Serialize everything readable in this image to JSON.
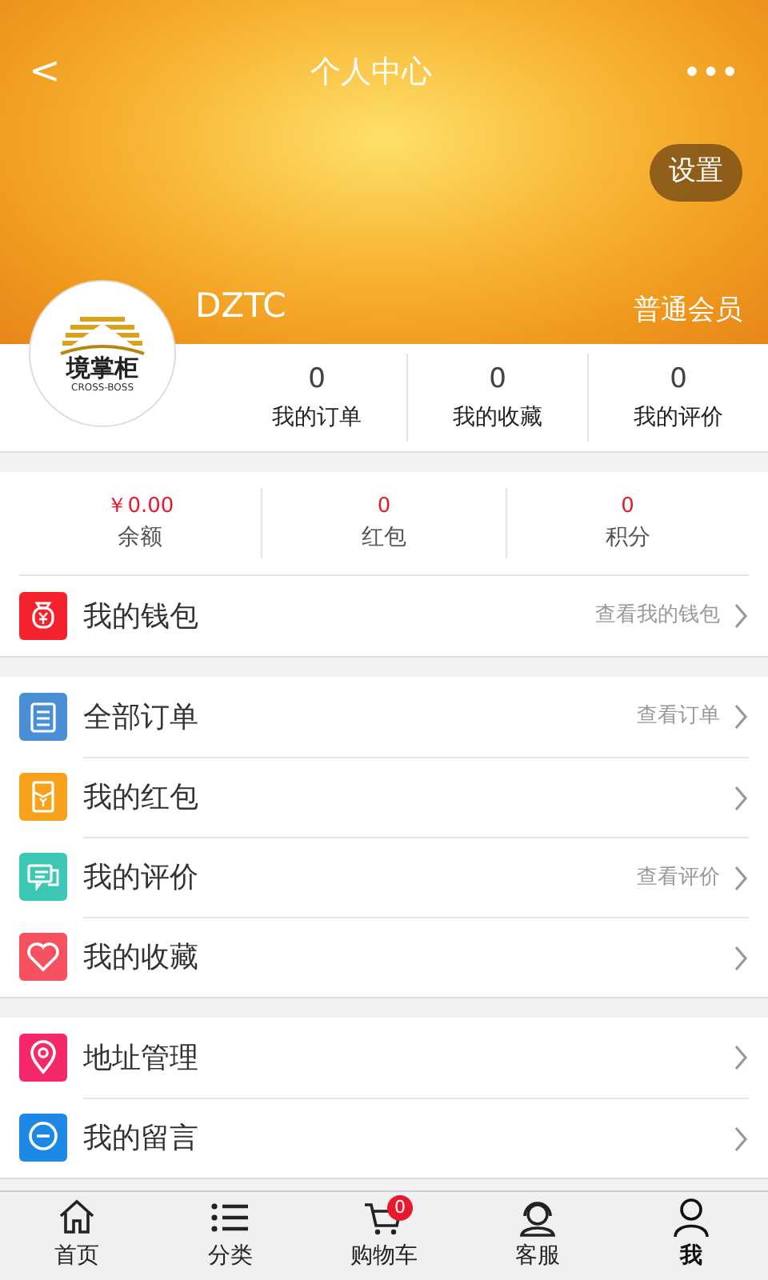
{
  "header": {
    "back": "<",
    "title": "个人中心",
    "more": "•••",
    "settings": "设置"
  },
  "profile": {
    "logo_name": "境掌柜",
    "logo_sub": "CROSS-BOSS",
    "username": "DZTC",
    "level": "普通会员"
  },
  "stats": [
    {
      "value": "0",
      "label": "我的订单"
    },
    {
      "value": "0",
      "label": "我的收藏"
    },
    {
      "value": "0",
      "label": "我的评价"
    }
  ],
  "assets": [
    {
      "value": "￥0.00",
      "label": "余额"
    },
    {
      "value": "0",
      "label": "红包"
    },
    {
      "value": "0",
      "label": "积分"
    }
  ],
  "groups": [
    [
      {
        "label": "我的钱包",
        "hint": "查看我的钱包",
        "color": "#f5222d"
      }
    ],
    [
      {
        "label": "全部订单",
        "hint": "查看订单",
        "color": "#4a8fd6"
      },
      {
        "label": "我的红包",
        "color": "#f7a21b"
      },
      {
        "label": "我的评价",
        "hint": "查看评价",
        "color": "#3cc8b4"
      },
      {
        "label": "我的收藏",
        "color": "#f5515f"
      }
    ],
    [
      {
        "label": "地址管理",
        "color": "#f5296a"
      },
      {
        "label": "我的留言",
        "color": "#1e88e5"
      }
    ]
  ],
  "tabbar": [
    {
      "label": "首页",
      "selected": false
    },
    {
      "label": "分类",
      "selected": false
    },
    {
      "label": "购物车",
      "selected": false,
      "badge": "0"
    },
    {
      "label": "客服",
      "selected": false
    },
    {
      "label": "我",
      "selected": true
    }
  ]
}
